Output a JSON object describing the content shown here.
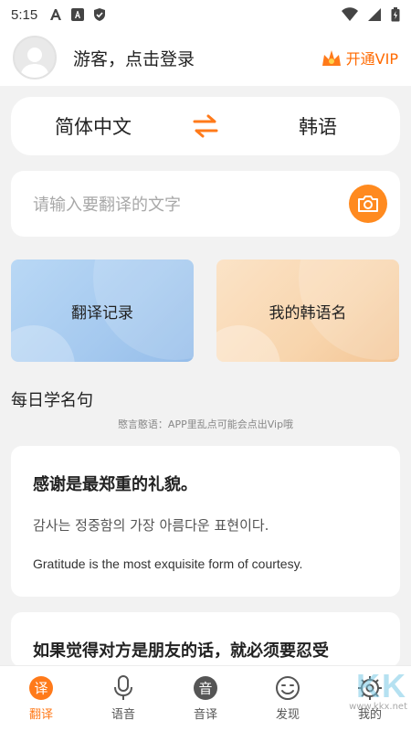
{
  "status_bar": {
    "time": "5:15"
  },
  "header": {
    "login_text": "游客，点击登录",
    "vip_label": "开通VIP"
  },
  "language_bar": {
    "source": "简体中文",
    "target": "韩语"
  },
  "input": {
    "placeholder": "请输入要翻译的文字"
  },
  "cards": [
    {
      "label": "翻译记录"
    },
    {
      "label": "我的韩语名"
    }
  ],
  "daily": {
    "title": "每日学名句",
    "note": "愍言憨语：APP里乱点可能会点出Vip哦"
  },
  "quotes": [
    {
      "zh": "感谢是最郑重的礼貌。",
      "ko": "감사는 정중함의 가장 아름다운 표현이다.",
      "en": "Gratitude is the most exquisite form of courtesy."
    },
    {
      "zh": "如果觉得对方是朋友的话，就必须要忍受"
    }
  ],
  "tabs": [
    {
      "label": "翻译",
      "icon": "translate-icon",
      "active": true
    },
    {
      "label": "语音",
      "icon": "microphone-icon"
    },
    {
      "label": "音译",
      "icon": "transliteration-icon"
    },
    {
      "label": "发现",
      "icon": "discover-icon"
    },
    {
      "label": "我的",
      "icon": "profile-gear-icon"
    }
  ],
  "watermark": {
    "logo": "KK",
    "url": "www.kkx.net"
  },
  "colors": {
    "accent": "#ff7a1a",
    "camera": "#ff8a1f",
    "card_blue": "#a5c9ef",
    "card_orange": "#f8d5ad",
    "background": "#f2f2f2"
  }
}
